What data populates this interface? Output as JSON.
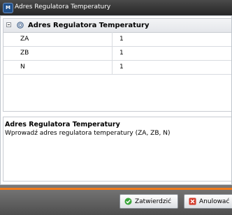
{
  "window": {
    "title": "Adres Regulatora Temperatury"
  },
  "grid": {
    "group_label": "Adres Regulatora Temperatury",
    "rows": [
      {
        "name": "ZA",
        "value": "1"
      },
      {
        "name": "ZB",
        "value": "1"
      },
      {
        "name": "N",
        "value": "1"
      }
    ]
  },
  "description": {
    "title": "Adres Regulatora Temperatury",
    "text": "Wprowadź adres regulatora temperatury (ZA, ZB, N)"
  },
  "footer": {
    "ok_label": "Zatwierdzić",
    "cancel_label": "Anulować"
  },
  "colors": {
    "accent": "#f07a1a",
    "ok_icon": "#3aa53a",
    "cancel_icon": "#d23a2a"
  }
}
